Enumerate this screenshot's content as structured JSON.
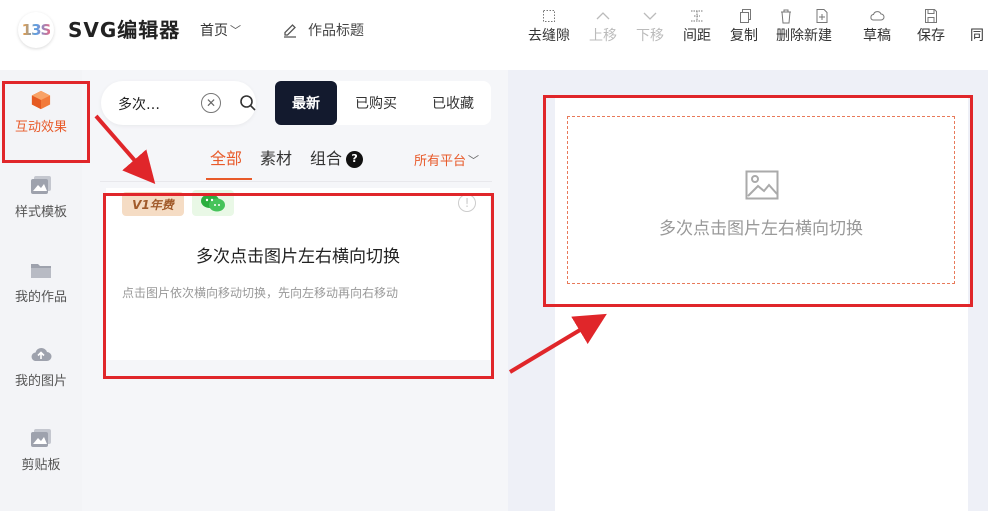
{
  "header": {
    "logo_text": "13S",
    "app_title": "SVG编辑器",
    "home_label": "首页",
    "work_title": "作品标题"
  },
  "toolbar": {
    "tools": [
      {
        "label": "去缝隙",
        "icon": "grid-dots-icon",
        "enabled": true
      },
      {
        "label": "上移",
        "icon": "chevron-up-icon",
        "enabled": false
      },
      {
        "label": "下移",
        "icon": "chevron-down-icon",
        "enabled": false
      },
      {
        "label": "间距",
        "icon": "spacing-icon",
        "enabled": true
      },
      {
        "label": "复制",
        "icon": "copy-icon",
        "enabled": true
      },
      {
        "label": "删除新建",
        "icon": "trash-icon",
        "icon2": "new-file-icon",
        "enabled": true
      },
      {
        "label": "草稿",
        "icon": "cloud-icon",
        "enabled": true
      },
      {
        "label": "保存",
        "icon": "save-icon",
        "enabled": true
      },
      {
        "label": "同",
        "icon": "partial-icon",
        "enabled": true
      }
    ]
  },
  "rail": {
    "items": [
      {
        "label": "互动效果",
        "icon": "cube-icon",
        "active": true
      },
      {
        "label": "样式模板",
        "icon": "template-icon",
        "active": false
      },
      {
        "label": "我的作品",
        "icon": "folder-icon",
        "active": false
      },
      {
        "label": "我的图片",
        "icon": "cloud-upload-icon",
        "active": false
      },
      {
        "label": "剪贴板",
        "icon": "clipboard-icon",
        "active": false
      }
    ]
  },
  "search": {
    "value": "多次…"
  },
  "filters": {
    "latest": "最新",
    "purchased": "已购买",
    "favorited": "已收藏"
  },
  "categories": {
    "all": "全部",
    "material": "素材",
    "combo": "组合",
    "help": "?",
    "platform": "所有平台"
  },
  "card": {
    "badge": "V1年费",
    "title": "多次点击图片左右横向切换",
    "description": "点击图片依次横向移动切换，先向左移动再向右移动",
    "info": "!"
  },
  "canvas": {
    "placeholder_title": "多次点击图片左右横向切换"
  },
  "colors": {
    "accent": "#e85a2a",
    "highlight": "#e0262a",
    "dark_button": "#131a2e"
  }
}
